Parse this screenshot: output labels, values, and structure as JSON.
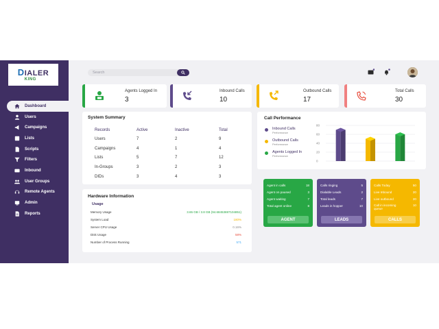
{
  "logo": {
    "line1_initial": "D",
    "line1_rest": "IALER",
    "line2": "KING"
  },
  "sidebar": {
    "items": [
      {
        "label": "Dashboard",
        "icon": "home-icon"
      },
      {
        "label": "Users",
        "icon": "user-icon"
      },
      {
        "label": "Campaigns",
        "icon": "megaphone-icon"
      },
      {
        "label": "Lists",
        "icon": "list-icon"
      },
      {
        "label": "Scripts",
        "icon": "document-icon"
      },
      {
        "label": "Filters",
        "icon": "filter-icon"
      },
      {
        "label": "Inbound",
        "icon": "inbound-icon"
      },
      {
        "label": "User Groups",
        "icon": "group-icon"
      },
      {
        "label": "Remote Agents",
        "icon": "headset-icon"
      },
      {
        "label": "Admin",
        "icon": "admin-icon"
      },
      {
        "label": "Reports",
        "icon": "report-icon"
      }
    ]
  },
  "search": {
    "placeholder": "Search"
  },
  "stats": [
    {
      "label": "Agents Logged In",
      "value": "3",
      "color": "#28a745"
    },
    {
      "label": "Inbound Calls",
      "value": "10",
      "color": "#5e4b8b"
    },
    {
      "label": "Outbound Calls",
      "value": "17",
      "color": "#f5b800"
    },
    {
      "label": "Total Calls",
      "value": "30",
      "color": "#f08080"
    }
  ],
  "system_summary": {
    "title": "System Summary",
    "headers": [
      "Records",
      "Active",
      "Inactive",
      "Total"
    ],
    "rows": [
      [
        "Users",
        "7",
        "2",
        "9"
      ],
      [
        "Campaigns",
        "4",
        "1",
        "4"
      ],
      [
        "Lists",
        "5",
        "7",
        "12"
      ],
      [
        "In-Groups",
        "3",
        "2",
        "3"
      ],
      [
        "DIDs",
        "3",
        "4",
        "3"
      ]
    ]
  },
  "hardware": {
    "title": "Hardware Information",
    "subtitle": "Usage",
    "rows": [
      {
        "label": "Memory Usage",
        "value": "3.65 GB / 3.8 GB (94.68453697104851)",
        "color": "#28a745"
      },
      {
        "label": "System Load",
        "value": "180%",
        "color": "#f5b800"
      },
      {
        "label": "Server CPU Usage",
        "value": "0.16%",
        "color": "#888888"
      },
      {
        "label": "Disk Usage",
        "value": "58%",
        "color": "#e74c3c"
      },
      {
        "label": "Number of Process Running",
        "value": "571",
        "color": "#3fa9f5"
      }
    ]
  },
  "call_performance": {
    "title": "Call Performance",
    "legend": [
      {
        "name": "Inbound Calls",
        "sub": "Performance",
        "color": "#5e4b8b"
      },
      {
        "name": "Outbound Calls",
        "sub": "Performance",
        "color": "#f5b800"
      },
      {
        "name": "Agents Logged In",
        "sub": "Performance",
        "color": "#28a745"
      }
    ]
  },
  "chart_data": {
    "type": "bar",
    "categories": [
      "Inbound Calls",
      "Outbound Calls",
      "Agents Logged In"
    ],
    "values": [
      70,
      50,
      60
    ],
    "colors": [
      "#5e4b8b",
      "#f5b800",
      "#28a745"
    ],
    "yticks": [
      0,
      20,
      40,
      60,
      80
    ],
    "ylim": [
      0,
      80
    ],
    "grid": true
  },
  "info_cards": [
    {
      "color": "#28a745",
      "button": "AGENT",
      "rows": [
        {
          "label": "Agent in calls",
          "value": "18"
        },
        {
          "label": "Agent on paused",
          "value": "3"
        },
        {
          "label": "Agent waiting",
          "value": "7"
        },
        {
          "label": "Total agent online",
          "value": "8"
        }
      ]
    },
    {
      "color": "#5e4b8b",
      "button": "LEADS",
      "rows": [
        {
          "label": "Calls ringing",
          "value": "5"
        },
        {
          "label": "Dialable Leads",
          "value": "2"
        },
        {
          "label": "Total leads",
          "value": "7"
        },
        {
          "label": "Leads in hopper",
          "value": "10"
        }
      ]
    },
    {
      "color": "#f5b800",
      "button": "CALLS",
      "rows": [
        {
          "label": "Calls Today",
          "value": "50"
        },
        {
          "label": "Live Inbound",
          "value": "20"
        },
        {
          "label": "Live outbound",
          "value": "20"
        },
        {
          "label": "Call in incoming queue",
          "value": "10"
        }
      ]
    }
  ]
}
